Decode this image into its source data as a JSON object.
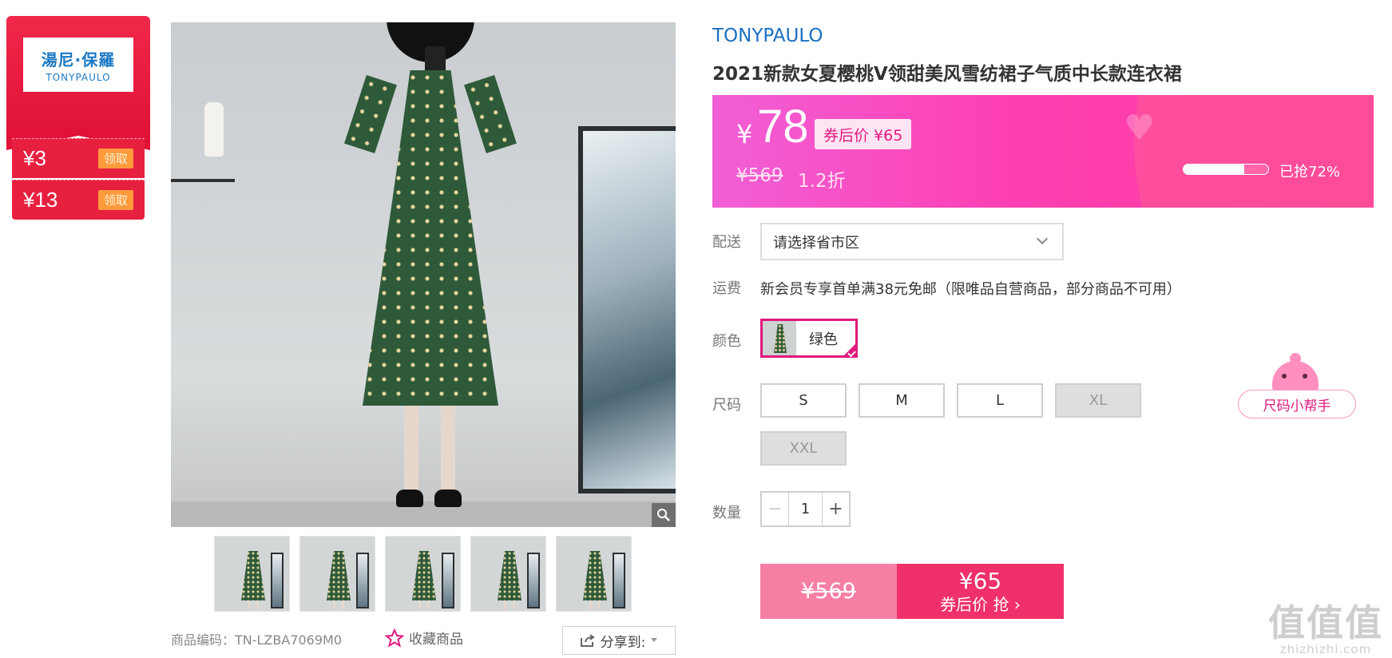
{
  "brand_card": {
    "logo_cn": "湯尼·保羅",
    "logo_en": "TONYPAULO",
    "coupons": [
      {
        "amount": "¥3",
        "button": "领取"
      },
      {
        "amount": "¥13",
        "button": "领取"
      }
    ]
  },
  "gallery": {
    "zoom_icon": "magnifier-icon",
    "thumbnail_count": 5
  },
  "meta": {
    "sku": "商品编码：TN-LZBA7069M0",
    "favorite_label": "收藏商品",
    "share_label": "分享到:"
  },
  "product": {
    "brand": "TONYPAULO",
    "title": "2021新款女夏樱桃V领甜美风雪纺裙子气质中长款连衣裙"
  },
  "price": {
    "symbol": "¥",
    "current": "78",
    "coupon_price": "券后价 ¥65",
    "original": "¥569",
    "discount": "1.2折",
    "sold_percent": 72,
    "sold_label": "已抢72%"
  },
  "shipping": {
    "label": "配送",
    "placeholder": "请选择省市区",
    "fee_label": "运费",
    "fee_text": "新会员专享首单满38元免邮（限唯品自营商品，部分商品不可用）"
  },
  "color": {
    "label": "颜色",
    "options": [
      {
        "name": "绿色",
        "selected": true
      }
    ]
  },
  "size": {
    "label": "尺码",
    "options": [
      {
        "name": "S",
        "available": true
      },
      {
        "name": "M",
        "available": true
      },
      {
        "name": "L",
        "available": true
      },
      {
        "name": "XL",
        "available": false
      },
      {
        "name": "XXL",
        "available": false
      }
    ],
    "helper": "尺码小帮手"
  },
  "quantity": {
    "label": "数量",
    "value": "1",
    "minus": "−",
    "plus": "+"
  },
  "buy": {
    "original": "¥569",
    "price": "¥65",
    "label": "券后价 抢 ›"
  },
  "watermark": {
    "big": "值值值",
    "small": "zhizhizhi.com"
  },
  "colors": {
    "accent_pink": "#e2187e",
    "brand_blue": "#1a6fc4",
    "coupon_red": "#e8203f",
    "buy_red": "#f0306b"
  }
}
